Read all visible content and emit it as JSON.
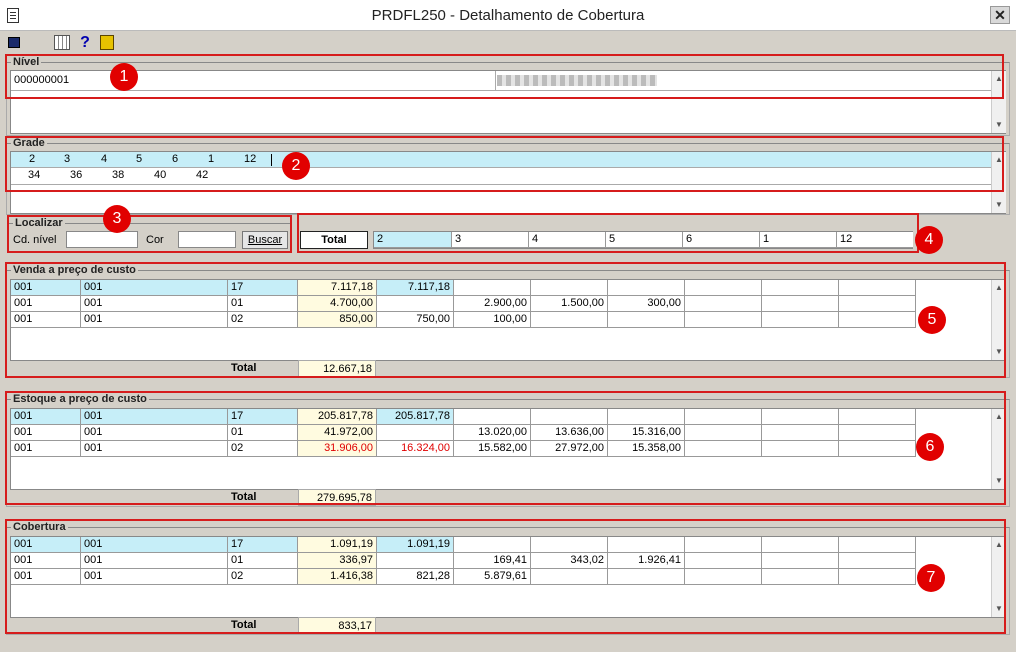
{
  "window": {
    "title": "PRDFL250 - Detalhamento de Cobertura",
    "close_glyph": "✕"
  },
  "toolbar": {
    "help_glyph": "?"
  },
  "nivel": {
    "label": "Nível",
    "code": "000000001"
  },
  "grade": {
    "label": "Grade",
    "row1": [
      "2",
      "3",
      "4",
      "5",
      "6",
      "1",
      "12"
    ],
    "row2": [
      "34",
      "36",
      "38",
      "40",
      "42"
    ]
  },
  "localizar": {
    "label": "Localizar",
    "cd_nivel_label": "Cd. nível",
    "cor_label": "Cor",
    "buscar_label": "Buscar"
  },
  "header_row": {
    "total_label": "Total",
    "sizes": [
      "2",
      "3",
      "4",
      "5",
      "6",
      "1",
      "12"
    ]
  },
  "badges": [
    "1",
    "2",
    "3",
    "4",
    "5",
    "6",
    "7"
  ],
  "sections": [
    {
      "label": "Venda a preço de custo",
      "total_label": "Total",
      "total": "12.667,18",
      "rows": [
        {
          "c1": "001",
          "c2": "001",
          "c3": "17",
          "total": "7.117,18",
          "sizes": [
            "7.117,18",
            "",
            "",
            "",
            "",
            "",
            ""
          ]
        },
        {
          "c1": "001",
          "c2": "001",
          "c3": "01",
          "total": "4.700,00",
          "sizes": [
            "",
            "2.900,00",
            "1.500,00",
            "300,00",
            "",
            "",
            ""
          ]
        },
        {
          "c1": "001",
          "c2": "001",
          "c3": "02",
          "total": "850,00",
          "sizes": [
            "750,00",
            "100,00",
            "",
            "",
            "",
            "",
            ""
          ]
        }
      ]
    },
    {
      "label": "Estoque a preço de custo",
      "total_label": "Total",
      "total": "279.695,78",
      "rows": [
        {
          "c1": "001",
          "c2": "001",
          "c3": "17",
          "total": "205.817,78",
          "sizes": [
            "205.817,78",
            "",
            "",
            "",
            "",
            "",
            ""
          ]
        },
        {
          "c1": "001",
          "c2": "001",
          "c3": "01",
          "total": "41.972,00",
          "sizes": [
            "",
            "13.020,00",
            "13.636,00",
            "15.316,00",
            "",
            "",
            ""
          ]
        },
        {
          "c1": "001",
          "c2": "001",
          "c3": "02",
          "total": "31.906,00",
          "sizes": [
            "16.324,00",
            "15.582,00",
            "27.972,00",
            "15.358,00",
            "",
            "",
            ""
          ]
        }
      ]
    },
    {
      "label": "Cobertura",
      "total_label": "Total",
      "total": "833,17",
      "rows": [
        {
          "c1": "001",
          "c2": "001",
          "c3": "17",
          "total": "1.091,19",
          "sizes": [
            "1.091,19",
            "",
            "",
            "",
            "",
            "",
            ""
          ]
        },
        {
          "c1": "001",
          "c2": "001",
          "c3": "01",
          "total": "336,97",
          "sizes": [
            "",
            "169,41",
            "343,02",
            "1.926,41",
            "",
            "",
            ""
          ]
        },
        {
          "c1": "001",
          "c2": "001",
          "c3": "02",
          "total": "1.416,38",
          "sizes": [
            "821,28",
            "5.879,61",
            "",
            "",
            "",
            "",
            ""
          ]
        }
      ]
    }
  ],
  "colors": {
    "highlight": "#c6eef8",
    "total_fill": "#fffbe0",
    "negative": "#e00000",
    "annotation": "#d61c1c"
  }
}
